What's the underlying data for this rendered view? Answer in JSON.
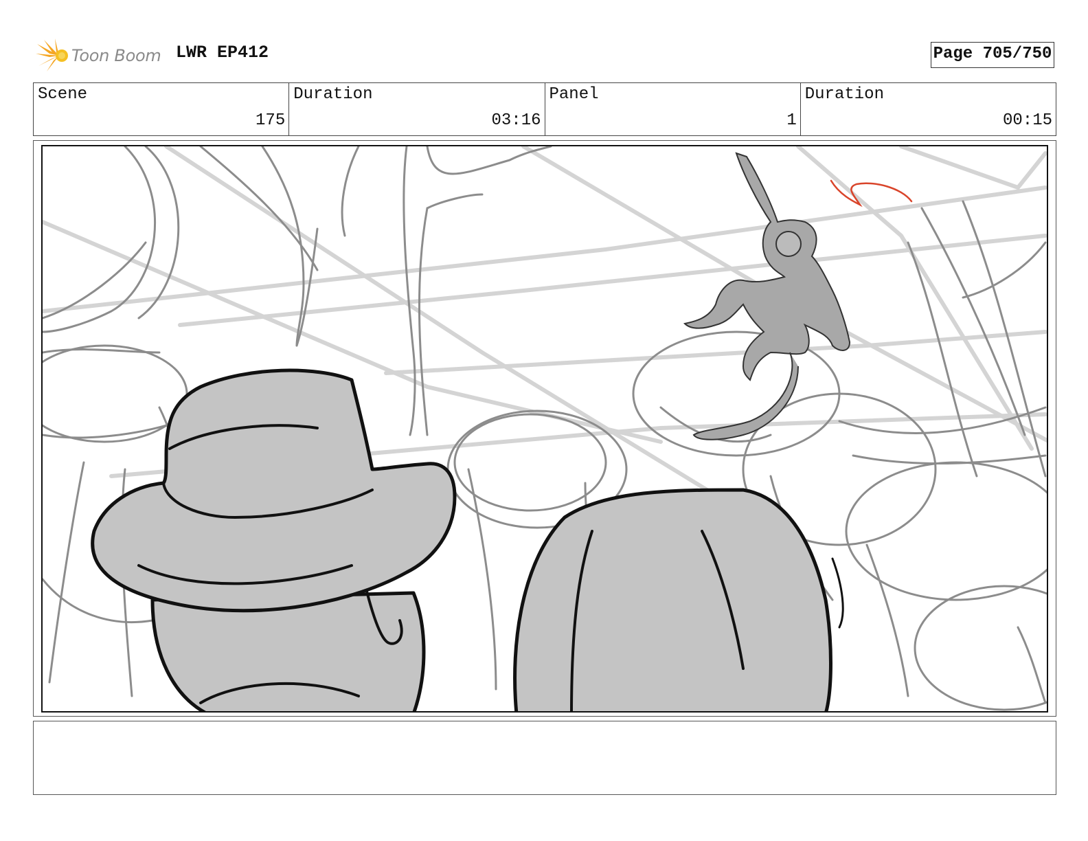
{
  "header": {
    "logo_text": "Toon Boom",
    "project_title": "LWR EP412",
    "page_label": "Page 705/750"
  },
  "info": {
    "scene_label": "Scene",
    "scene_value": "175",
    "scene_duration_label": "Duration",
    "scene_duration_value": "03:16",
    "panel_label": "Panel",
    "panel_value": "1",
    "panel_duration_label": "Duration",
    "panel_duration_value": "00:15"
  },
  "notes": {
    "text": ""
  },
  "colors": {
    "logo_orange": "#f5a623",
    "logo_text": "#8a8a8a",
    "sketch_fill": "#c4c4c4",
    "sketch_line": "#111111",
    "background_line": "#8c8c8c",
    "accent_arrow": "#d9442a"
  }
}
